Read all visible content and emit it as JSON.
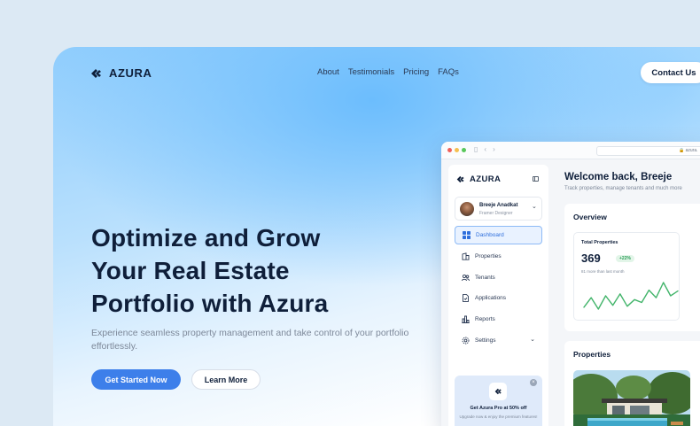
{
  "brand": {
    "name": "AZURA"
  },
  "nav": {
    "items": [
      "About",
      "Testimonials",
      "Pricing",
      "FAQs"
    ],
    "contact_label": "Contact Us"
  },
  "hero": {
    "headline_lines": [
      "Optimize and Grow",
      "Your Real Estate",
      "Portfolio with Azura"
    ],
    "subtext": "Experience seamless property management and take control of your portfolio effortlessly.",
    "primary_cta": "Get Started Now",
    "secondary_cta": "Learn More"
  },
  "app": {
    "url": "azura.",
    "sidebar": {
      "logo": "AZURA",
      "user": {
        "name": "Breeje Anadkat",
        "role": "Framer Designer"
      },
      "menu": [
        {
          "label": "Dashboard",
          "icon": "grid-icon",
          "active": true
        },
        {
          "label": "Properties",
          "icon": "building-icon"
        },
        {
          "label": "Tenants",
          "icon": "users-icon"
        },
        {
          "label": "Applications",
          "icon": "document-icon"
        },
        {
          "label": "Reports",
          "icon": "bar-chart-icon"
        },
        {
          "label": "Settings",
          "icon": "gear-icon",
          "has_submenu": true
        }
      ],
      "promo": {
        "title": "Get Azura Pro at 50% off",
        "subtitle": "Upgrade now & enjoy the premium features!"
      }
    },
    "main": {
      "title": "Welcome back, Breeje",
      "subtitle": "Track properties, manage tenants and much more",
      "overview": {
        "title": "Overview",
        "stat": {
          "label": "Total Properties",
          "value": "369",
          "badge": "+22%",
          "note": "81 more than last month"
        },
        "sparkline": [
          12,
          22,
          10,
          24,
          14,
          26,
          13,
          20,
          17,
          30,
          22,
          38,
          24,
          29
        ]
      },
      "properties": {
        "title": "Properties"
      }
    }
  },
  "colors": {
    "accent": "#3d7fea",
    "dark": "#0f1f3a",
    "positive": "#2e9e59",
    "sparkline": "#42b46a"
  }
}
